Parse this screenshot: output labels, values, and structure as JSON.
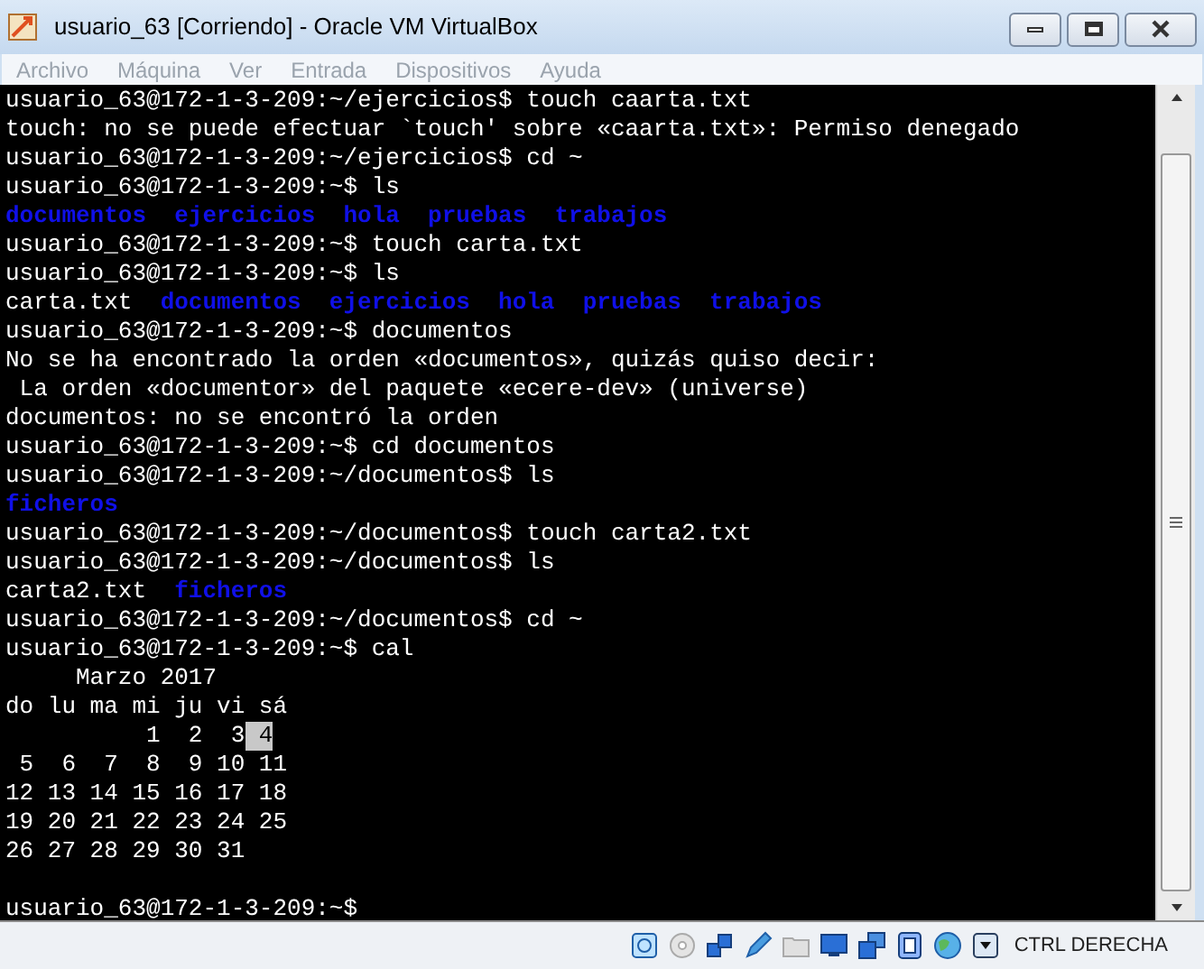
{
  "window": {
    "title": "usuario_63 [Corriendo] - Oracle VM VirtualBox"
  },
  "menu": [
    {
      "label": "Archivo",
      "disabled": true
    },
    {
      "label": "Máquina",
      "disabled": true
    },
    {
      "label": "Ver",
      "disabled": true
    },
    {
      "label": "Entrada",
      "disabled": true
    },
    {
      "label": "Dispositivos",
      "disabled": true
    },
    {
      "label": "Ayuda",
      "disabled": true
    }
  ],
  "terminal": {
    "lines": [
      {
        "kind": "text",
        "segments": [
          {
            "kind": "plain",
            "text": "usuario_63@172-1-3-209:~/ejercicios$ touch caarta.txt"
          }
        ]
      },
      {
        "kind": "text",
        "segments": [
          {
            "kind": "plain",
            "text": "touch: no se puede efectuar `touch' sobre «caarta.txt»: Permiso denegado"
          }
        ]
      },
      {
        "kind": "text",
        "segments": [
          {
            "kind": "plain",
            "text": "usuario_63@172-1-3-209:~/ejercicios$ cd ~"
          }
        ]
      },
      {
        "kind": "text",
        "segments": [
          {
            "kind": "plain",
            "text": "usuario_63@172-1-3-209:~$ ls"
          }
        ]
      },
      {
        "kind": "listing",
        "segments": [
          {
            "kind": "dir",
            "text": "documentos"
          },
          {
            "kind": "dir",
            "text": "ejercicios"
          },
          {
            "kind": "dir",
            "text": "hola"
          },
          {
            "kind": "dir",
            "text": "pruebas"
          },
          {
            "kind": "dir",
            "text": "trabajos"
          }
        ]
      },
      {
        "kind": "text",
        "segments": [
          {
            "kind": "plain",
            "text": "usuario_63@172-1-3-209:~$ touch carta.txt"
          }
        ]
      },
      {
        "kind": "text",
        "segments": [
          {
            "kind": "plain",
            "text": "usuario_63@172-1-3-209:~$ ls"
          }
        ]
      },
      {
        "kind": "listing",
        "segments": [
          {
            "kind": "plain",
            "text": "carta.txt"
          },
          {
            "kind": "dir",
            "text": "documentos"
          },
          {
            "kind": "dir",
            "text": "ejercicios"
          },
          {
            "kind": "dir",
            "text": "hola"
          },
          {
            "kind": "dir",
            "text": "pruebas"
          },
          {
            "kind": "dir",
            "text": "trabajos"
          }
        ]
      },
      {
        "kind": "text",
        "segments": [
          {
            "kind": "plain",
            "text": "usuario_63@172-1-3-209:~$ documentos"
          }
        ]
      },
      {
        "kind": "text",
        "segments": [
          {
            "kind": "plain",
            "text": "No se ha encontrado la orden «documentos», quizás quiso decir:"
          }
        ]
      },
      {
        "kind": "text",
        "segments": [
          {
            "kind": "plain",
            "text": " La orden «documentor» del paquete «ecere-dev» (universe)"
          }
        ]
      },
      {
        "kind": "text",
        "segments": [
          {
            "kind": "plain",
            "text": "documentos: no se encontró la orden"
          }
        ]
      },
      {
        "kind": "text",
        "segments": [
          {
            "kind": "plain",
            "text": "usuario_63@172-1-3-209:~$ cd documentos"
          }
        ]
      },
      {
        "kind": "text",
        "segments": [
          {
            "kind": "plain",
            "text": "usuario_63@172-1-3-209:~/documentos$ ls"
          }
        ]
      },
      {
        "kind": "listing",
        "segments": [
          {
            "kind": "dir",
            "text": "ficheros"
          }
        ]
      },
      {
        "kind": "text",
        "segments": [
          {
            "kind": "plain",
            "text": "usuario_63@172-1-3-209:~/documentos$ touch carta2.txt"
          }
        ]
      },
      {
        "kind": "text",
        "segments": [
          {
            "kind": "plain",
            "text": "usuario_63@172-1-3-209:~/documentos$ ls"
          }
        ]
      },
      {
        "kind": "listing",
        "segments": [
          {
            "kind": "plain",
            "text": "carta2.txt"
          },
          {
            "kind": "dir",
            "text": "ficheros"
          }
        ]
      },
      {
        "kind": "text",
        "segments": [
          {
            "kind": "plain",
            "text": "usuario_63@172-1-3-209:~/documentos$ cd ~"
          }
        ]
      },
      {
        "kind": "text",
        "segments": [
          {
            "kind": "plain",
            "text": "usuario_63@172-1-3-209:~$ cal"
          }
        ]
      },
      {
        "kind": "text",
        "segments": [
          {
            "kind": "plain",
            "text": "     Marzo 2017"
          }
        ]
      },
      {
        "kind": "text",
        "segments": [
          {
            "kind": "plain",
            "text": "do lu ma mi ju vi sá"
          }
        ]
      },
      {
        "kind": "text",
        "segments": [
          {
            "kind": "plain",
            "text": "          1  2  3"
          },
          {
            "kind": "today",
            "text": " 4"
          }
        ]
      },
      {
        "kind": "text",
        "segments": [
          {
            "kind": "plain",
            "text": " 5  6  7  8  9 10 11"
          }
        ]
      },
      {
        "kind": "text",
        "segments": [
          {
            "kind": "plain",
            "text": "12 13 14 15 16 17 18"
          }
        ]
      },
      {
        "kind": "text",
        "segments": [
          {
            "kind": "plain",
            "text": "19 20 21 22 23 24 25"
          }
        ]
      },
      {
        "kind": "text",
        "segments": [
          {
            "kind": "plain",
            "text": "26 27 28 29 30 31"
          }
        ]
      },
      {
        "kind": "blank"
      },
      {
        "kind": "text",
        "segments": [
          {
            "kind": "plain",
            "text": "usuario_63@172-1-3-209:~$"
          }
        ]
      }
    ]
  },
  "status_bar": {
    "host_key": "CTRL DERECHA"
  }
}
